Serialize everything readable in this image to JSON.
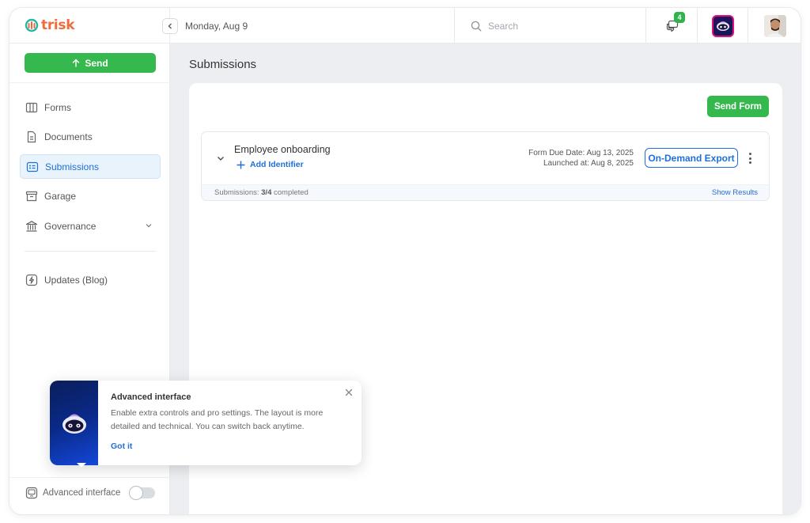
{
  "app": {
    "name": "trisk"
  },
  "header": {
    "date": "Monday, Aug 9",
    "search_placeholder": "Search",
    "chat_badge": "4"
  },
  "sidebar": {
    "send_label": "Send",
    "items": [
      {
        "label": "Forms",
        "icon": "forms-icon",
        "active": false
      },
      {
        "label": "Documents",
        "icon": "document-icon",
        "active": false
      },
      {
        "label": "Submissions",
        "icon": "submissions-icon",
        "active": true
      },
      {
        "label": "Garage",
        "icon": "archive-icon",
        "active": false
      },
      {
        "label": "Governance",
        "icon": "bank-icon",
        "active": false
      }
    ],
    "updates_label": "Updates (Blog)",
    "advanced_label": "Advanced interface",
    "advanced_enabled": false
  },
  "main": {
    "title": "Submissions",
    "send_form_label": "Send Form",
    "submission": {
      "title": "Employee onboarding",
      "add_identifier": "Add Identifier",
      "due_date": "Form Due Date: Aug 13, 2025",
      "launched": "Launched at: Aug 8, 2025",
      "export_label": "On-Demand Export",
      "footer_prefix": "Submissions:",
      "footer_count": "3/4",
      "footer_suffix": "completed",
      "show_results": "Show Results"
    }
  },
  "popover": {
    "title": "Advanced interface",
    "body": "Enable extra controls and pro settings. The layout is more detailed and technical. You can switch back anytime.",
    "cta": "Got it"
  },
  "colors": {
    "brand_orange": "#ef6b3b",
    "brand_teal": "#2bb5a8",
    "primary_green": "#35b84d",
    "link_blue": "#1f6fd8",
    "badge_green": "#2fb34a"
  }
}
